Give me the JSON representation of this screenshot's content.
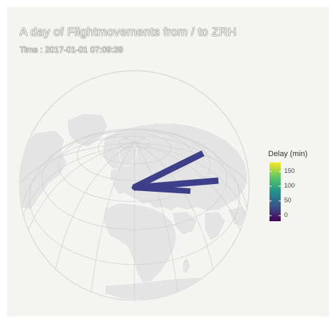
{
  "title": "A day of Flightmovements from / to ZRH",
  "subtitle": "Time : 2017-01-01 07:09:39",
  "legend": {
    "title": "Delay (min)",
    "ticks": [
      "150",
      "100",
      "50",
      "0"
    ],
    "tick_values": [
      150,
      100,
      50,
      0
    ],
    "range": [
      -20,
      175
    ]
  },
  "colors": {
    "panel": "#f4f4f0",
    "land": "#e4e4e4",
    "graticule": "#d2d2d2",
    "flight": "#3e3f8a"
  },
  "map": {
    "projection": "orthographic",
    "center_label": "ZRH",
    "flights": [
      {
        "delay": 2
      },
      {
        "delay": 3
      },
      {
        "delay": 1
      }
    ]
  }
}
